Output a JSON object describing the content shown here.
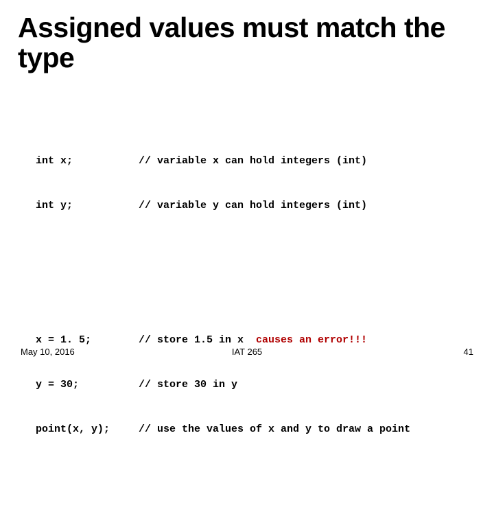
{
  "title": "Assigned values must match the type",
  "code": {
    "block1": {
      "line1": {
        "decl": "int x;",
        "comment": "// variable x can hold integers (int)"
      },
      "line2": {
        "decl": "int y;",
        "comment": "// variable y can hold integers (int)"
      }
    },
    "block2": {
      "line1": {
        "decl": "x = 1. 5;",
        "comment_prefix": "// store 1.5 in x  ",
        "error": "causes an error!!!"
      },
      "line2": {
        "decl": "y = 30;",
        "comment": "// store 30 in y"
      },
      "line3": {
        "decl": "point(x, y);",
        "comment": "// use the values of x and y to draw a point"
      }
    }
  },
  "footer": {
    "date": "May 10, 2016",
    "course": "IAT 265",
    "page": "41"
  }
}
